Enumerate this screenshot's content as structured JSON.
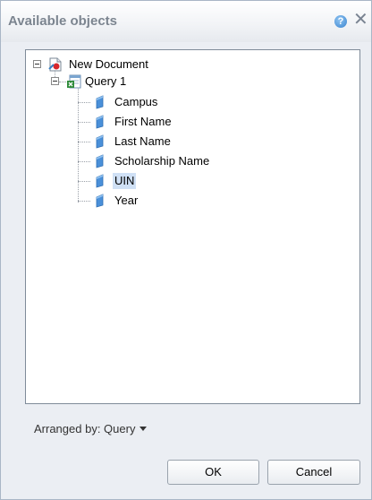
{
  "dialog": {
    "title": "Available objects",
    "help_icon_glyph": "?",
    "close_icon_glyph": "✕"
  },
  "tree": {
    "root": {
      "label": "New Document",
      "icon": "document-icon"
    },
    "query": {
      "label": "Query 1",
      "icon": "query-icon"
    },
    "objects": [
      {
        "label": "Campus",
        "icon": "dimension-icon",
        "selected": false
      },
      {
        "label": "First Name",
        "icon": "dimension-icon",
        "selected": false
      },
      {
        "label": "Last Name",
        "icon": "dimension-icon",
        "selected": false
      },
      {
        "label": "Scholarship Name",
        "icon": "dimension-icon",
        "selected": false
      },
      {
        "label": "UIN",
        "icon": "dimension-icon",
        "selected": true
      },
      {
        "label": "Year",
        "icon": "dimension-icon",
        "selected": false
      }
    ]
  },
  "footer": {
    "arranged_by": "Arranged by: Query"
  },
  "buttons": {
    "ok": "OK",
    "cancel": "Cancel"
  },
  "colors": {
    "selection": "#cfe0f5",
    "dimension": "#4a90d9",
    "title": "#7c8590"
  }
}
